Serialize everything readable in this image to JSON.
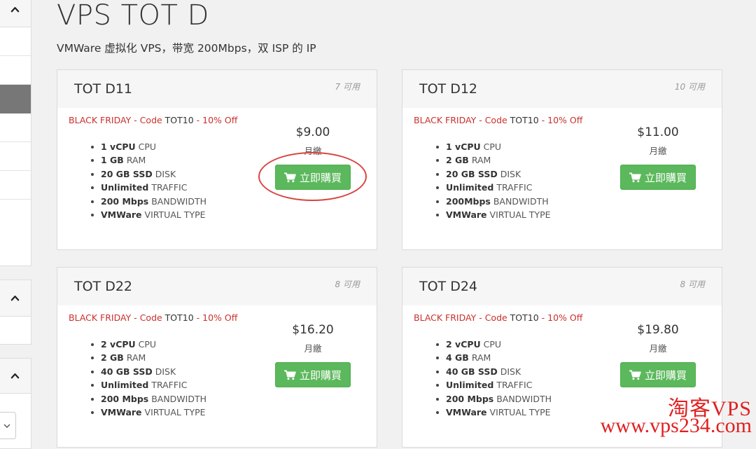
{
  "page": {
    "title": "VPS TOT D",
    "subtitle": "VMWare 虚拟化 VPS，带宽 200Mbps，双 ISP 的 IP"
  },
  "products": [
    {
      "name": "TOT D11",
      "availability": "7 可用",
      "promo_prefix": "BLACK FRIDAY - Code ",
      "promo_code": "TOT10",
      "promo_suffix": " - 10% Off",
      "price": "$9.00",
      "cycle": "月繳",
      "buy_label": "立即購買",
      "specs": [
        {
          "value": "1 vCPU",
          "label": " CPU"
        },
        {
          "value": "1 GB",
          "label": " RAM"
        },
        {
          "value": "20 GB SSD",
          "label": " DISK"
        },
        {
          "value": "Unlimited",
          "label": " TRAFFIC"
        },
        {
          "value": "200 Mbps",
          "label": " BANDWIDTH"
        },
        {
          "value": "VMWare",
          "label": " VIRTUAL TYPE"
        }
      ]
    },
    {
      "name": "TOT D12",
      "availability": "10 可用",
      "promo_prefix": "BLACK FRIDAY - Code ",
      "promo_code": "TOT10",
      "promo_suffix": " - 10% Off",
      "price": "$11.00",
      "cycle": "月繳",
      "buy_label": "立即購買",
      "specs": [
        {
          "value": "1 vCPU",
          "label": " CPU"
        },
        {
          "value": "2 GB",
          "label": " RAM"
        },
        {
          "value": "20 GB SSD",
          "label": " DISK"
        },
        {
          "value": "Unlimited",
          "label": " TRAFFIC"
        },
        {
          "value": "200Mbps",
          "label": " BANDWIDTH"
        },
        {
          "value": "VMWare",
          "label": " VIRTUAL TYPE"
        }
      ]
    },
    {
      "name": "TOT D22",
      "availability": "8 可用",
      "promo_prefix": "BLACK FRIDAY - Code ",
      "promo_code": "TOT10",
      "promo_suffix": " - 10% Off",
      "price": "$16.20",
      "cycle": "月繳",
      "buy_label": "立即購買",
      "specs": [
        {
          "value": "2 vCPU",
          "label": " CPU"
        },
        {
          "value": "2 GB",
          "label": " RAM"
        },
        {
          "value": "40 GB SSD",
          "label": " DISK"
        },
        {
          "value": "Unlimited",
          "label": " TRAFFIC"
        },
        {
          "value": "200 Mbps",
          "label": " BANDWIDTH"
        },
        {
          "value": "VMWare",
          "label": " VIRTUAL TYPE"
        }
      ]
    },
    {
      "name": "TOT D24",
      "availability": "8 可用",
      "promo_prefix": "BLACK FRIDAY - Code ",
      "promo_code": "TOT10",
      "promo_suffix": " - 10% Off",
      "price": "$19.80",
      "cycle": "月繳",
      "buy_label": "立即購買",
      "specs": [
        {
          "value": "2 vCPU",
          "label": " CPU"
        },
        {
          "value": "4 GB",
          "label": " RAM"
        },
        {
          "value": "40 GB SSD",
          "label": " DISK"
        },
        {
          "value": "Unlimited",
          "label": " TRAFFIC"
        },
        {
          "value": "200 Mbps",
          "label": " BANDWIDTH"
        },
        {
          "value": "VMWare",
          "label": " VIRTUAL TYPE"
        }
      ]
    }
  ],
  "watermark": {
    "brand": "淘客VPS",
    "url": "www.vps234.com"
  },
  "colors": {
    "promo": "#c9302c",
    "buy_button": "#5cb85c",
    "annotation": "#d9443f",
    "watermark": "#e02020"
  },
  "icons": {
    "collapse": "chevron-up-icon",
    "cart": "shopping-cart-icon",
    "select": "chevron-down-icon"
  }
}
